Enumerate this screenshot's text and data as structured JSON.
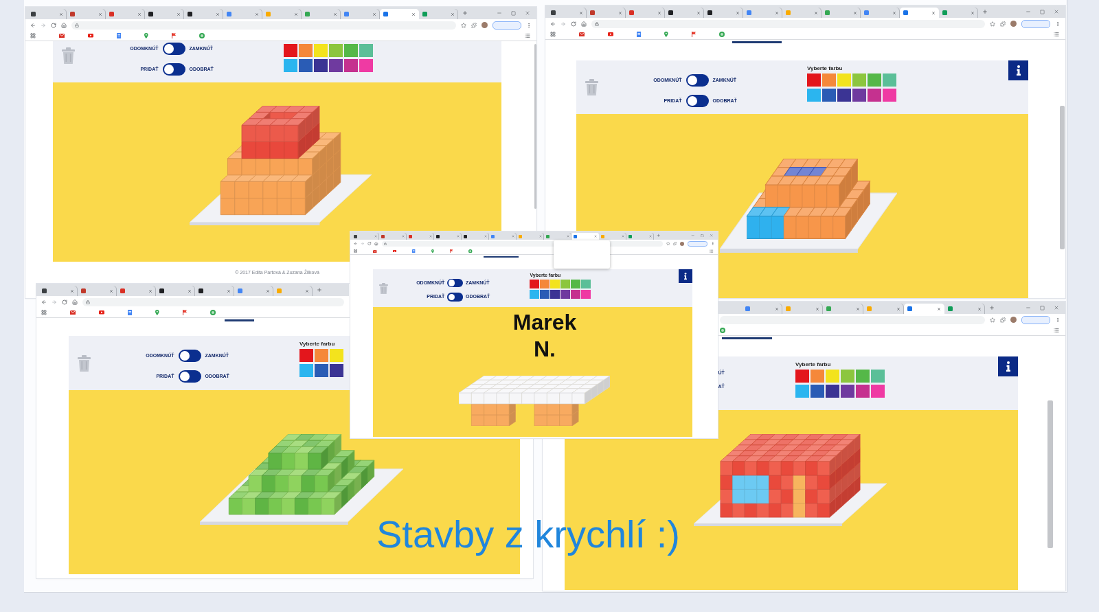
{
  "windows": [
    {
      "tabs": [
        {
          "selected": false,
          "color": "#3c4043"
        },
        {
          "selected": false,
          "color": "#c0392b"
        },
        {
          "selected": false,
          "color": "#d93025"
        },
        {
          "selected": false,
          "color": "#202124"
        },
        {
          "selected": false,
          "color": "#202124"
        },
        {
          "selected": false,
          "color": "#4285f4"
        },
        {
          "selected": false,
          "color": "#f9ab00"
        },
        {
          "selected": false,
          "color": "#34a853"
        },
        {
          "selected": false,
          "color": "#4285f4"
        },
        {
          "selected": true,
          "color": "#1a73e8"
        },
        {
          "selected": false,
          "color": "#0f9d58"
        }
      ],
      "toolbar": {
        "toggles": [
          {
            "left": "ODOMKNÚŤ",
            "on": false,
            "right": "ZAMKNÚŤ"
          },
          {
            "left": "PRIDAŤ",
            "on": false,
            "right": "ODOBRAŤ"
          }
        ],
        "swatches": [
          {
            "color": "#e3161c"
          },
          {
            "color": "#f5883a"
          },
          {
            "color": "#f3e31d"
          },
          {
            "color": "#8cc63e"
          },
          {
            "color": "#55b848"
          },
          {
            "color": "#5bbf98"
          },
          {
            "color": "#2bb5ef"
          },
          {
            "color": "#2a5cb5"
          },
          {
            "color": "#3b3494"
          },
          {
            "color": "#6f3a9f"
          },
          {
            "color": "#c5318f"
          },
          {
            "color": "#ef3aa3"
          }
        ],
        "info_button": false
      },
      "footer": "© 2017 Edita Partová & Zuzana Žilková"
    },
    {
      "tabs": [
        {
          "selected": false,
          "color": "#3c4043"
        },
        {
          "selected": false,
          "color": "#c0392b"
        },
        {
          "selected": false,
          "color": "#d93025"
        },
        {
          "selected": false,
          "color": "#202124"
        },
        {
          "selected": false,
          "color": "#202124"
        },
        {
          "selected": false,
          "color": "#4285f4"
        },
        {
          "selected": false,
          "color": "#f9ab00"
        },
        {
          "selected": false,
          "color": "#34a853"
        },
        {
          "selected": false,
          "color": "#4285f4"
        },
        {
          "selected": true,
          "color": "#1a73e8"
        },
        {
          "selected": false,
          "color": "#0f9d58"
        }
      ],
      "toolbar": {
        "toggles": [
          {
            "left": "ODOMKNÚŤ",
            "on": false,
            "right": "ZAMKNÚŤ"
          },
          {
            "left": "PRIDAŤ",
            "on": false,
            "right": "ODOBRAŤ"
          }
        ],
        "palette_title": "Vyberte farbu",
        "swatches": [
          {
            "color": "#e3161c"
          },
          {
            "color": "#f5883a"
          },
          {
            "color": "#f3e31d"
          },
          {
            "color": "#8cc63e"
          },
          {
            "color": "#55b848"
          },
          {
            "color": "#5bbf98"
          },
          {
            "color": "#2bb5ef"
          },
          {
            "color": "#2a5cb5"
          },
          {
            "color": "#3b3494"
          },
          {
            "color": "#6f3a9f"
          },
          {
            "color": "#c5318f"
          },
          {
            "color": "#ef3aa3"
          }
        ],
        "info_button": true
      }
    },
    {
      "tabs": [
        {
          "selected": false,
          "color": "#3c4043"
        },
        {
          "selected": false,
          "color": "#c0392b"
        },
        {
          "selected": false,
          "color": "#d93025"
        },
        {
          "selected": false,
          "color": "#202124"
        },
        {
          "selected": false,
          "color": "#202124"
        },
        {
          "selected": false,
          "color": "#4285f4"
        },
        {
          "selected": false,
          "color": "#f9ab00"
        },
        {
          "selected": false,
          "color": "#34a853"
        },
        {
          "selected": true,
          "color": "#1a73e8"
        },
        {
          "selected": false,
          "color": "#f9ab00"
        },
        {
          "selected": false,
          "color": "#0f9d58"
        }
      ],
      "toolbar": {
        "toggles": [
          {
            "left": "ODOMKNÚŤ",
            "on": false,
            "right": "ZAMKNÚŤ"
          },
          {
            "left": "PRIDAŤ",
            "on": false,
            "right": "ODOBRAŤ"
          }
        ],
        "palette_title": "Vyberte farbu",
        "swatches": [
          {
            "color": "#e3161c"
          },
          {
            "color": "#f5883a"
          },
          {
            "color": "#f3e31d"
          },
          {
            "color": "#8cc63e"
          },
          {
            "color": "#55b848"
          },
          {
            "color": "#5bbf98"
          },
          {
            "color": "#2bb5ef"
          },
          {
            "color": "#2a5cb5"
          },
          {
            "color": "#3b3494"
          },
          {
            "color": "#6f3a9f"
          },
          {
            "color": "#c5318f"
          },
          {
            "color": "#ef3aa3"
          }
        ],
        "info_button": true
      },
      "caption": "Marek N."
    },
    {
      "tabs": [
        {
          "selected": false,
          "color": "#3c4043"
        },
        {
          "selected": false,
          "color": "#c0392b"
        },
        {
          "selected": false,
          "color": "#d93025"
        },
        {
          "selected": false,
          "color": "#202124"
        },
        {
          "selected": false,
          "color": "#202124"
        },
        {
          "selected": false,
          "color": "#4285f4"
        },
        {
          "selected": false,
          "color": "#f9ab00"
        }
      ],
      "toolbar": {
        "toggles": [
          {
            "left": "ODOMKNÚŤ",
            "on": false,
            "right": "ZAMKNÚŤ"
          },
          {
            "left": "PRIDAŤ",
            "on": false,
            "right": "ODOBRAŤ"
          }
        ],
        "palette_title": "Vyberte farbu",
        "swatches": [
          {
            "color": "#e3161c"
          },
          {
            "color": "#f5883a"
          },
          {
            "color": "#f3e31d"
          },
          {
            "color": "#2bb5ef"
          },
          {
            "color": "#2a5cb5"
          },
          {
            "color": "#3b3494"
          }
        ],
        "info_button": false
      }
    },
    {
      "tabs": [
        {
          "selected": false,
          "color": "#4285f4"
        },
        {
          "selected": false,
          "color": "#f9ab00"
        },
        {
          "selected": false,
          "color": "#34a853"
        },
        {
          "selected": false,
          "color": "#f9ab00"
        },
        {
          "selected": true,
          "color": "#1a73e8"
        },
        {
          "selected": false,
          "color": "#0f9d58"
        }
      ],
      "toolbar": {
        "toggles": [
          {
            "right": "ÚŤ"
          },
          {
            "right": "AŤ"
          }
        ],
        "palette_title": "Vyberte farbu",
        "swatches": [
          {
            "color": "#e3161c"
          },
          {
            "color": "#f5883a"
          },
          {
            "color": "#f3e31d"
          },
          {
            "color": "#8cc63e"
          },
          {
            "color": "#55b848"
          },
          {
            "color": "#5bbf98"
          },
          {
            "color": "#2bb5ef"
          },
          {
            "color": "#2a5cb5"
          },
          {
            "color": "#3b3494"
          },
          {
            "color": "#6f3a9f"
          },
          {
            "color": "#c5318f"
          },
          {
            "color": "#ef3aa3"
          }
        ],
        "info_button": true
      }
    }
  ],
  "title": "Stavby z krychlí :)"
}
